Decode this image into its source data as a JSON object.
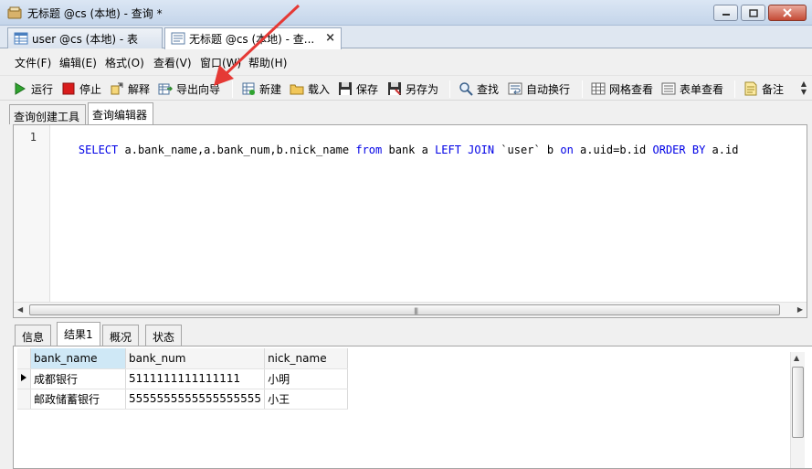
{
  "window": {
    "title": "无标题 @cs (本地) - 查询 *",
    "controls": [
      "minimize",
      "maximize",
      "close"
    ]
  },
  "doc_tabs": [
    {
      "label": "user @cs (本地) - 表"
    },
    {
      "label": "无标题 @cs (本地) - 查..."
    }
  ],
  "menu": [
    "文件(F)",
    "编辑(E)",
    "格式(O)",
    "查看(V)",
    "窗口(W)",
    "帮助(H)"
  ],
  "toolbar": {
    "run": "运行",
    "stop": "停止",
    "explain": "解释",
    "export_wizard": "导出向导",
    "new": "新建",
    "load": "载入",
    "save": "保存",
    "save_as": "另存为",
    "find": "查找",
    "word_wrap": "自动换行",
    "grid_view": "网格查看",
    "form_view": "表单查看",
    "memo": "备注"
  },
  "editor_tabs": [
    "查询创建工具",
    "查询编辑器"
  ],
  "editor": {
    "line_number": "1",
    "tokens": [
      {
        "t": "SELECT",
        "kw": true
      },
      {
        "t": " a.bank_name,a.bank_num,b.nick_name ",
        "kw": false
      },
      {
        "t": "from",
        "kw": true
      },
      {
        "t": " bank a ",
        "kw": false
      },
      {
        "t": "LEFT JOIN",
        "kw": true
      },
      {
        "t": " `user` b ",
        "kw": false
      },
      {
        "t": "on",
        "kw": true
      },
      {
        "t": " a.uid=b.id ",
        "kw": false
      },
      {
        "t": "ORDER BY",
        "kw": true
      },
      {
        "t": " a.id",
        "kw": false
      }
    ]
  },
  "result_tabs": [
    "信息",
    "结果1",
    "概况",
    "状态"
  ],
  "grid": {
    "columns": [
      "bank_name",
      "bank_num",
      "nick_name"
    ],
    "rows": [
      [
        "成都银行",
        "5111111111111111",
        "小明"
      ],
      [
        "邮政储蓄银行",
        "5555555555555555555",
        "小王"
      ]
    ]
  },
  "colors": {
    "keyword": "#0000e6",
    "annotation_arrow": "#e53935",
    "selected_header": "#cfe8f6"
  }
}
